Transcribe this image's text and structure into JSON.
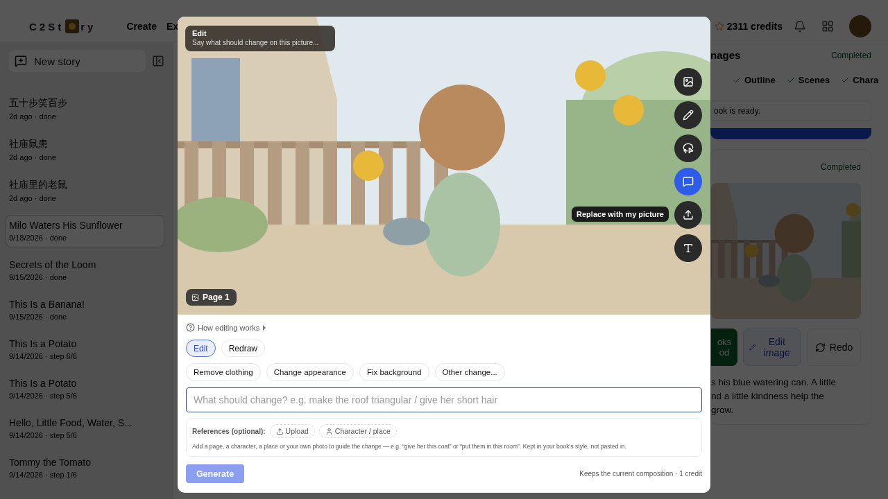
{
  "header": {
    "logo_left": "C2St",
    "logo_right": "ry",
    "nav": [
      "Create",
      "Ex"
    ],
    "credits": "2311 credits"
  },
  "sidebar": {
    "new_story": "New story",
    "stories": [
      {
        "title": "五十步笑百步",
        "meta": "2d ago · done",
        "selected": false
      },
      {
        "title": "社庙鼠患",
        "meta": "2d ago · done",
        "selected": false
      },
      {
        "title": "社庙里的老鼠",
        "meta": "2d ago · done",
        "selected": false
      },
      {
        "title": "Milo Waters His Sunflower",
        "meta": "9/18/2026 · done",
        "selected": true
      },
      {
        "title": "Secrets of the Loom",
        "meta": "9/15/2026 · done",
        "selected": false
      },
      {
        "title": "This Is a Banana!",
        "meta": "9/15/2026 · done",
        "selected": false
      },
      {
        "title": "This Is a Potato",
        "meta": "9/14/2026 · step 6/6",
        "selected": false
      },
      {
        "title": "This Is a Potato",
        "meta": "9/14/2026 · step 5/6",
        "selected": false
      },
      {
        "title": "Hello, Little Food, Water, S...",
        "meta": "9/14/2026 · step 5/6",
        "selected": false
      },
      {
        "title": "Tommy the Tomato",
        "meta": "9/14/2026 · step 1/6",
        "selected": false
      }
    ]
  },
  "right_panel": {
    "heading": "nages",
    "status": "Completed",
    "steps": [
      "Outline",
      "Scenes",
      "Chara"
    ],
    "notice": "ook is ready.",
    "card": {
      "status": "Completed",
      "approve_lines": [
        "oks",
        "od"
      ],
      "edit_button": "Edit image",
      "redo_button": "Redo",
      "caption_lines": [
        "s his blue watering can. A little",
        "nd a little kindness help the",
        "grow."
      ]
    }
  },
  "editor": {
    "hint": {
      "title": "Edit",
      "text": "Say what should change on this picture..."
    },
    "page_badge": "Page 1",
    "tools": [
      {
        "selected": false
      },
      {
        "selected": false
      },
      {
        "selected": false
      },
      {
        "selected": true
      },
      {
        "selected": false,
        "tooltip": "Replace with my picture"
      },
      {
        "selected": false
      }
    ],
    "help_link": "How editing works",
    "modes": [
      {
        "label": "Edit",
        "selected": true
      },
      {
        "label": "Redraw",
        "selected": false
      }
    ],
    "chips": [
      "Remove clothing",
      "Change appearance",
      "Fix background",
      "Other change..."
    ],
    "input": {
      "placeholder": "What should change? e.g. make the roof triangular / give her short hair"
    },
    "references": {
      "label": "References (optional):",
      "upload": "Upload",
      "character": "Character / place",
      "help": "Add a page, a character, a place or your own photo to guide the change — e.g. “give her this coat” or “put them in this room”. Kept in your book's style, not pasted in."
    },
    "generate": {
      "label": "Generate",
      "disabled": true
    },
    "footer": "Keeps the current composition · 1 credit"
  }
}
